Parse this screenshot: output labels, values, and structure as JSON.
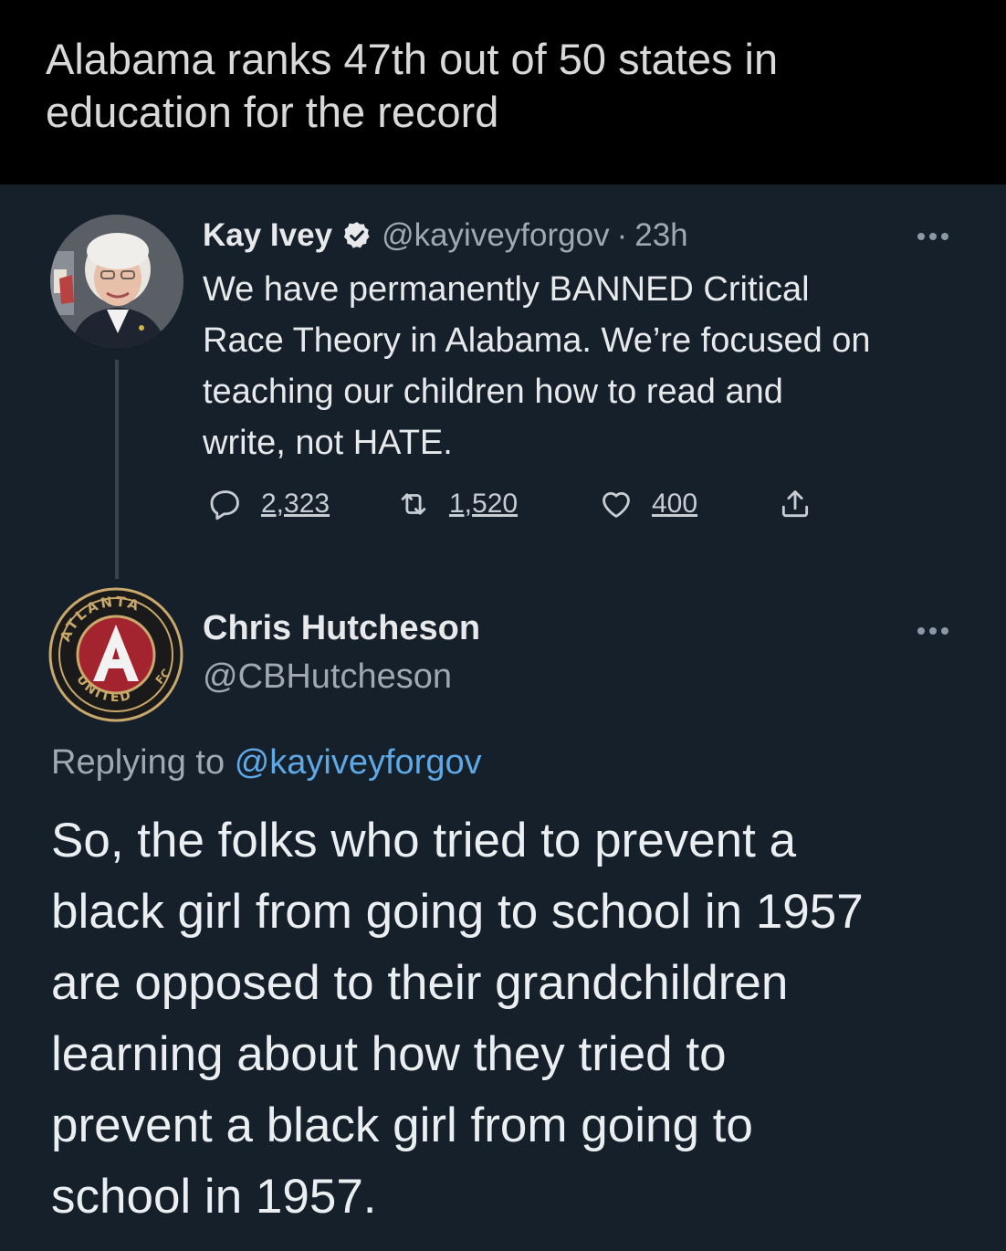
{
  "caption": {
    "line1": "Alabama ranks 47th out of 50 states in",
    "line2": "education for the record"
  },
  "tweet": {
    "author_name": "Kay Ivey",
    "handle": "@kayiveyforgov",
    "separator": "·",
    "time": "23h",
    "verified": true,
    "body_lines": [
      "We have permanently BANNED Critical",
      "Race Theory in Alabama. We’re focused on",
      "teaching our children how to read and",
      "write, not HATE."
    ],
    "actions": {
      "replies": "2,323",
      "retweets": "1,520",
      "likes": "400"
    },
    "icons": [
      "reply-icon",
      "retweet-icon",
      "like-icon",
      "share-icon",
      "more-icon",
      "verified-icon"
    ]
  },
  "reply": {
    "author_name": "Chris Hutcheson",
    "handle": "@CBHutcheson",
    "avatar_logo_text": [
      "ATLANTA",
      "UNITED",
      "FC",
      "A"
    ],
    "replying_prefix": "Replying to",
    "replying_handle": "@kayiveyforgov",
    "body_lines": [
      "So, the folks who tried to prevent a",
      "black girl from going to school in 1957",
      "are opposed to their grandchildren",
      "learning about how they tried to",
      "prevent a black girl from going to",
      "school in 1957."
    ]
  },
  "colors": {
    "background": "#15202b",
    "caption_background": "#000000",
    "link": "#5fa8e6",
    "verified": "#1d9bf0",
    "muted_text": "#a0a8b0"
  }
}
